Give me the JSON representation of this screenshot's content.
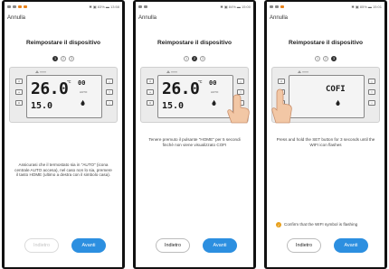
{
  "screens": [
    {
      "status_left": "∗ ∗∗ ∗",
      "status_right": "✱ ▣ 83% ▬ 13:58",
      "cancel_label": "Annulla",
      "title": "Reimpostare il dispositivo",
      "steps": [
        "1",
        "2",
        "3"
      ],
      "active_step": 1,
      "display": {
        "big": "26.0",
        "small": "15.0",
        "unit": "℃",
        "time": "00",
        "mode": "AUTO"
      },
      "description": "Assicurasi che il termostato sia in \"AUTO\" (icona centrale AUTO accesa), nel caso non lo sia, premere il tasto HOME (ultimo a destra con il simbolo casa).",
      "back_label": "Indietro",
      "next_label": "Avanti"
    },
    {
      "status_left": "",
      "status_right": "✱ ▣ 84% ▬ 15:00",
      "cancel_label": "Annulla",
      "title": "Reimpostare il dispositivo",
      "steps": [
        "1",
        "2",
        "3"
      ],
      "active_step": 2,
      "display": {
        "big": "26.0",
        "small": "15.0",
        "unit": "℃",
        "time": "00",
        "mode": "AUTO"
      },
      "description": "Tenere premuto il pulsante \"HOME\" per 5 secondi finchè non viene visualizzato COFI",
      "back_label": "Indietro",
      "next_label": "Avanti"
    },
    {
      "status_left": "",
      "status_right": "✱ ▣ 85% ▬ 15:01",
      "cancel_label": "Annulla",
      "title": "Reimpostare il dispositivo",
      "steps": [
        "1",
        "2",
        "3"
      ],
      "active_step": 3,
      "display": {
        "cofi": "COFI"
      },
      "description": "Press and hold the SET button for 3 seconds until the WIFI icon flashes",
      "confirm_text": "Confirm that the WIFI symbol is flashing",
      "back_label": "Indietro",
      "next_label": "Avanti"
    }
  ],
  "colors": {
    "accent": "#2c8fe0",
    "check": "#e8a01c",
    "status_orange": "#e9831c"
  }
}
